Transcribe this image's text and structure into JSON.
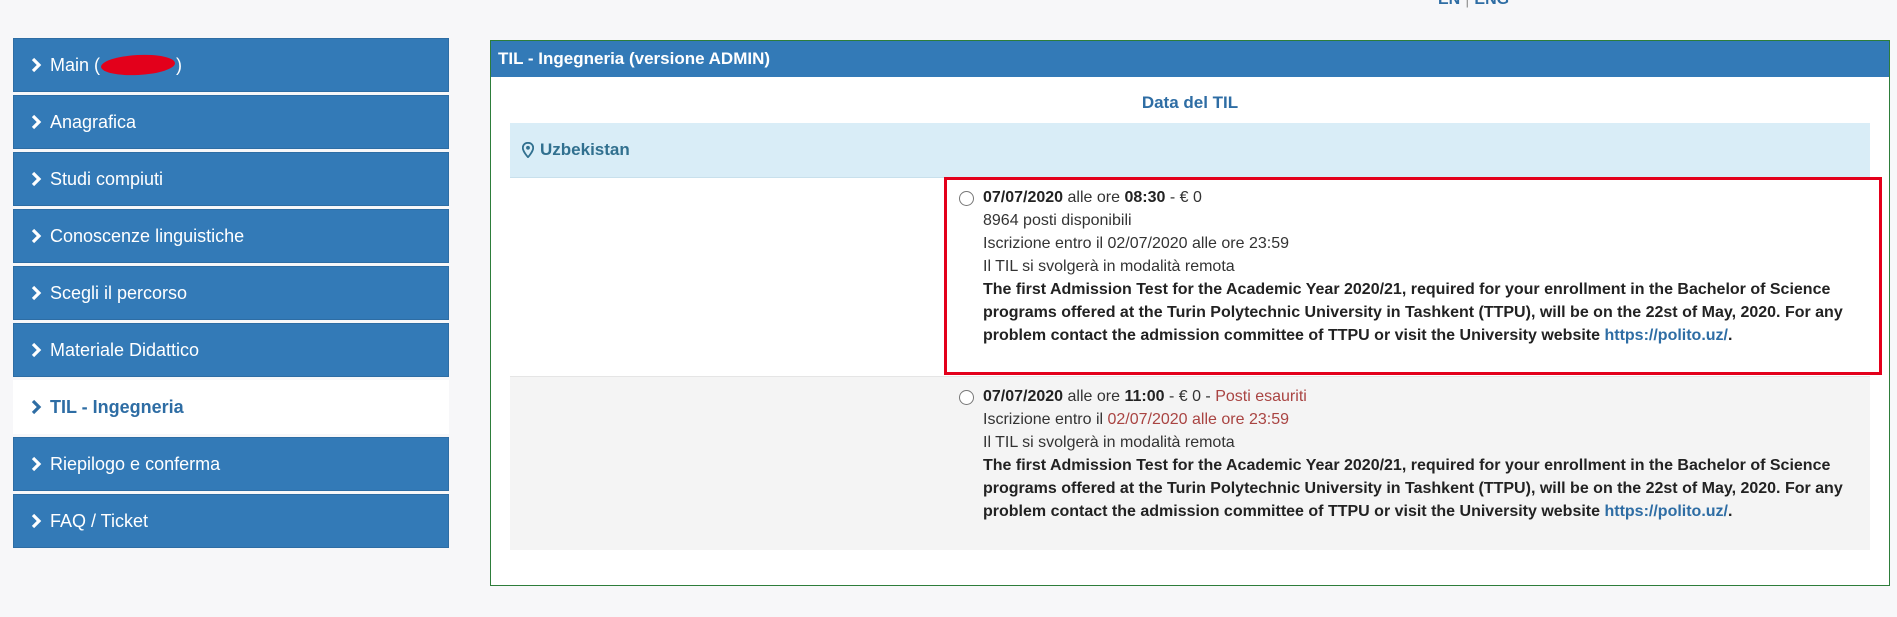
{
  "top_links": {
    "left": "EN",
    "right": "ENG"
  },
  "sidebar": {
    "items": [
      {
        "label_pre": "Main (",
        "label_post": ")",
        "redacted": true
      },
      {
        "label": "Anagrafica"
      },
      {
        "label": "Studi compiuti"
      },
      {
        "label": "Conoscenze linguistiche"
      },
      {
        "label": "Scegli il percorso"
      },
      {
        "label": "Materiale Didattico"
      },
      {
        "label": "TIL - Ingegneria",
        "active": true
      },
      {
        "label": "Riepilogo e conferma"
      },
      {
        "label": "FAQ / Ticket"
      }
    ]
  },
  "panel": {
    "title": "TIL - Ingegneria (versione ADMIN)",
    "date_title": "Data del TIL",
    "country": "Uzbekistan",
    "sessions": [
      {
        "date": "07/07/2020",
        "at_hours": "alle ore",
        "time": "08:30",
        "price": "- € 0",
        "seats": "8964 posti disponibili",
        "enroll_prefix": "Iscrizione entro il",
        "enroll_date": "02/07/2020 alle ore 23:59",
        "mode": "Il TIL si svolgerà in modalità remota",
        "description": "The first Admission Test for the Academic Year 2020/21, required for your enrollment in the Bachelor of Science programs offered at the Turin Polytechnic University in Tashkent (TTPU), will be on the 22st of May, 2020. For any problem contact the admission committee of TTPU or visit the University website",
        "link": "https://polito.uz/",
        "link_suffix": "."
      },
      {
        "date": "07/07/2020",
        "at_hours": "alle ore",
        "time": "11:00",
        "price": "- € 0 -",
        "status": "Posti esauriti",
        "enroll_prefix": "Iscrizione entro il",
        "enroll_date": "02/07/2020 alle ore 23:59",
        "mode": "Il TIL si svolgerà in modalità remota",
        "description": "The first Admission Test for the Academic Year 2020/21, required for your enrollment in the Bachelor of Science programs offered at the Turin Polytechnic University in Tashkent (TTPU), will be on the 22st of May, 2020. For any problem contact the admission committee of TTPU or visit the University website",
        "link": "https://polito.uz/",
        "link_suffix": "."
      }
    ]
  },
  "colors": {
    "primary": "#337ab7",
    "country_bg": "#d9edf7",
    "highlight": "#e3001b",
    "panel_border": "#2d7d3a",
    "sold_out": "#a94442"
  }
}
